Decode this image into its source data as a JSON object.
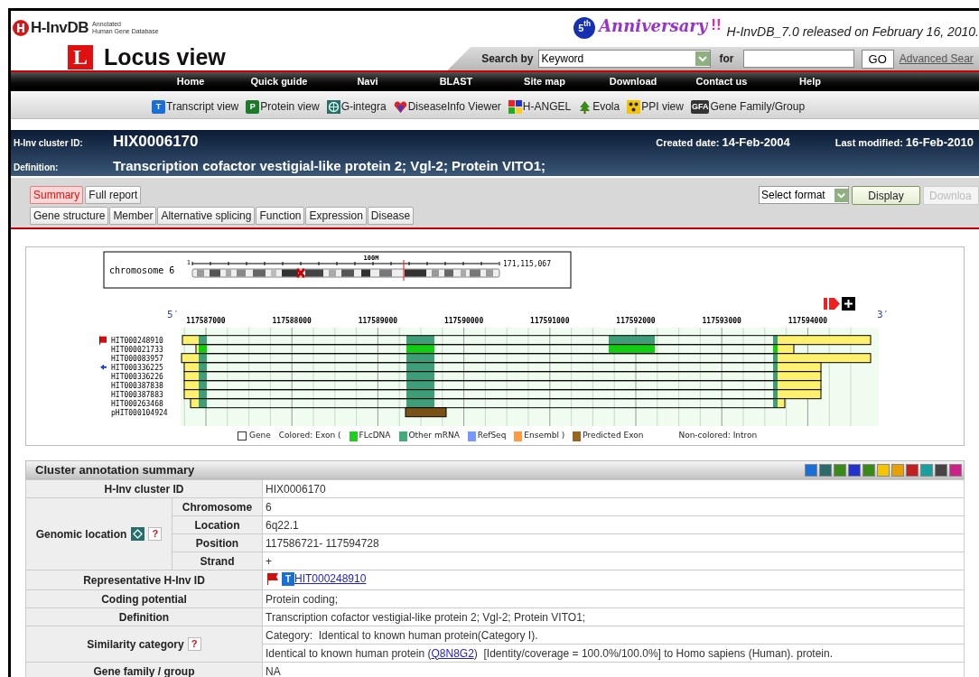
{
  "header": {
    "logo": {
      "name": "H-InvDB",
      "subtitle": [
        "Annotated",
        "Human Gene Database"
      ]
    },
    "page_icon": "L",
    "page_title": "Locus view",
    "anniversary": {
      "badge": "5$^{th}$",
      "word": "Anniversary",
      "marks": "!!"
    },
    "release_note": "H-InvDB_7.0 released on February 16, 2010."
  },
  "search": {
    "label": "Search by",
    "select_value": "Keyword",
    "for_label": "for",
    "button": "GO",
    "advanced_link": "Advanced Sear"
  },
  "nav": [
    "Home",
    "Quick guide",
    "Navi",
    "BLAST",
    "Site map",
    "Download",
    "Contact us",
    "Help"
  ],
  "tools": [
    {
      "kind": "letter",
      "glyph": "T",
      "color": "#1a6fd6",
      "label": "Transcript view"
    },
    {
      "kind": "letter",
      "glyph": "P",
      "color": "#1d7a2a",
      "label": "Protein view"
    },
    {
      "kind": "globe",
      "label": "G-integra"
    },
    {
      "kind": "heart",
      "label": "DiseaseInfo Viewer"
    },
    {
      "kind": "mosaic",
      "label": "H-ANGEL"
    },
    {
      "kind": "tree",
      "label": "Evola"
    },
    {
      "kind": "dots",
      "label": "PPI view"
    },
    {
      "kind": "letter",
      "glyph": "GFA",
      "color": "#333333",
      "label": "Gene Family/Group"
    }
  ],
  "cluster": {
    "id_label": "H-Inv cluster ID:",
    "id": "HIX0006170",
    "definition_label": "Definition:",
    "definition": "Transcription cofactor vestigial-like protein 2; Vgl-2; Protein VITO1;",
    "created_label": "Created date:",
    "created": "14-Feb-2004",
    "modified_label": "Last modified:",
    "modified": "16-Feb-2010"
  },
  "tabs_row1": [
    {
      "label": "Summary",
      "selected": true
    },
    {
      "label": "Full report",
      "selected": false
    }
  ],
  "tabs_row2": [
    {
      "label": "Gene structure",
      "selected": false
    },
    {
      "label": "Member",
      "selected": false
    },
    {
      "label": "Alternative splicing",
      "selected": false
    },
    {
      "label": "Function",
      "selected": false
    },
    {
      "label": "Expression",
      "selected": false
    },
    {
      "label": "Disease",
      "selected": false
    }
  ],
  "format": {
    "select_value": "Select format",
    "display_button": "Display",
    "download_button": {
      "label": "Downloa",
      "disabled": true
    }
  },
  "locus_map": {
    "chromosome_label": "chromosome 6",
    "scale_start": "1",
    "scale_mid": "100M",
    "scale_end": "171,115,067",
    "five_prime": "5′",
    "three_prime": "3′",
    "positions": [
      "117587000",
      "117588000",
      "117589000",
      "117590000",
      "117591000",
      "117592000",
      "117593000",
      "117594000"
    ],
    "tracks": [
      {
        "name": "HIT000248910",
        "kind": "flag"
      },
      {
        "name": "HIT000021733",
        "kind": "plain"
      },
      {
        "name": "HIT000083957",
        "kind": "plain"
      },
      {
        "name": "HIT000336225",
        "kind": "arrow"
      },
      {
        "name": "HIT000336226",
        "kind": "plain"
      },
      {
        "name": "HIT000387838",
        "kind": "plain"
      },
      {
        "name": "HIT000387883",
        "kind": "plain"
      },
      {
        "name": "HIT000263468",
        "kind": "plain"
      },
      {
        "name": "pHIT000104924",
        "kind": "plain"
      }
    ],
    "legend": [
      {
        "kind": "box",
        "label": "Gene"
      },
      {
        "kind": "text",
        "label": "Colored:  Exon ("
      },
      {
        "kind": "swatch",
        "color": "#22cc22",
        "label": "FLcDNA"
      },
      {
        "kind": "swatch",
        "color": "#44aa77",
        "label": "Other mRNA"
      },
      {
        "kind": "swatch",
        "color": "#7799ff",
        "label": "RefSeq"
      },
      {
        "kind": "swatch",
        "color": "#ff9944",
        "label": "Ensembl )"
      },
      {
        "kind": "swatch",
        "color": "#996622",
        "label": "Predicted Exon"
      },
      {
        "kind": "text",
        "label": "Non-colored: Intron"
      }
    ]
  },
  "summary": {
    "title": "Cluster annotation summary",
    "rows": [
      {
        "kind": "simple",
        "label": "H-Inv cluster ID",
        "value": "HIX0006170"
      },
      {
        "kind": "group",
        "label": "Genomic location",
        "help": "?",
        "subrows": [
          {
            "label": "Chromosome",
            "value": "6"
          },
          {
            "label": "Location",
            "value": "6q22.1"
          },
          {
            "label": "Position",
            "value": "117586721- 117594728"
          },
          {
            "label": "Strand",
            "value": "+"
          }
        ]
      },
      {
        "kind": "representative",
        "label": "Representative H-Inv ID",
        "badge": "T",
        "link": "HIT000248910"
      },
      {
        "kind": "simple",
        "label": "Coding potential",
        "value": "Protein coding;"
      },
      {
        "kind": "simple",
        "label": "Definition",
        "value": "Transcription cofactor vestigial-like protein 2; Vgl-2; Protein VITO1;"
      },
      {
        "kind": "similarity",
        "label": "Similarity category",
        "help": "?",
        "category": "Category:  Identical to known human protein(Category I).",
        "match": {
          "before": "Identical to known human protein (",
          "link": "Q8N8G2",
          "after": ")  [Identity/coverage = 100.0%/100.0%] to Homo sapiens (Human). protein."
        }
      },
      {
        "kind": "simple",
        "label": "Gene family / group",
        "value": "NA"
      }
    ]
  }
}
